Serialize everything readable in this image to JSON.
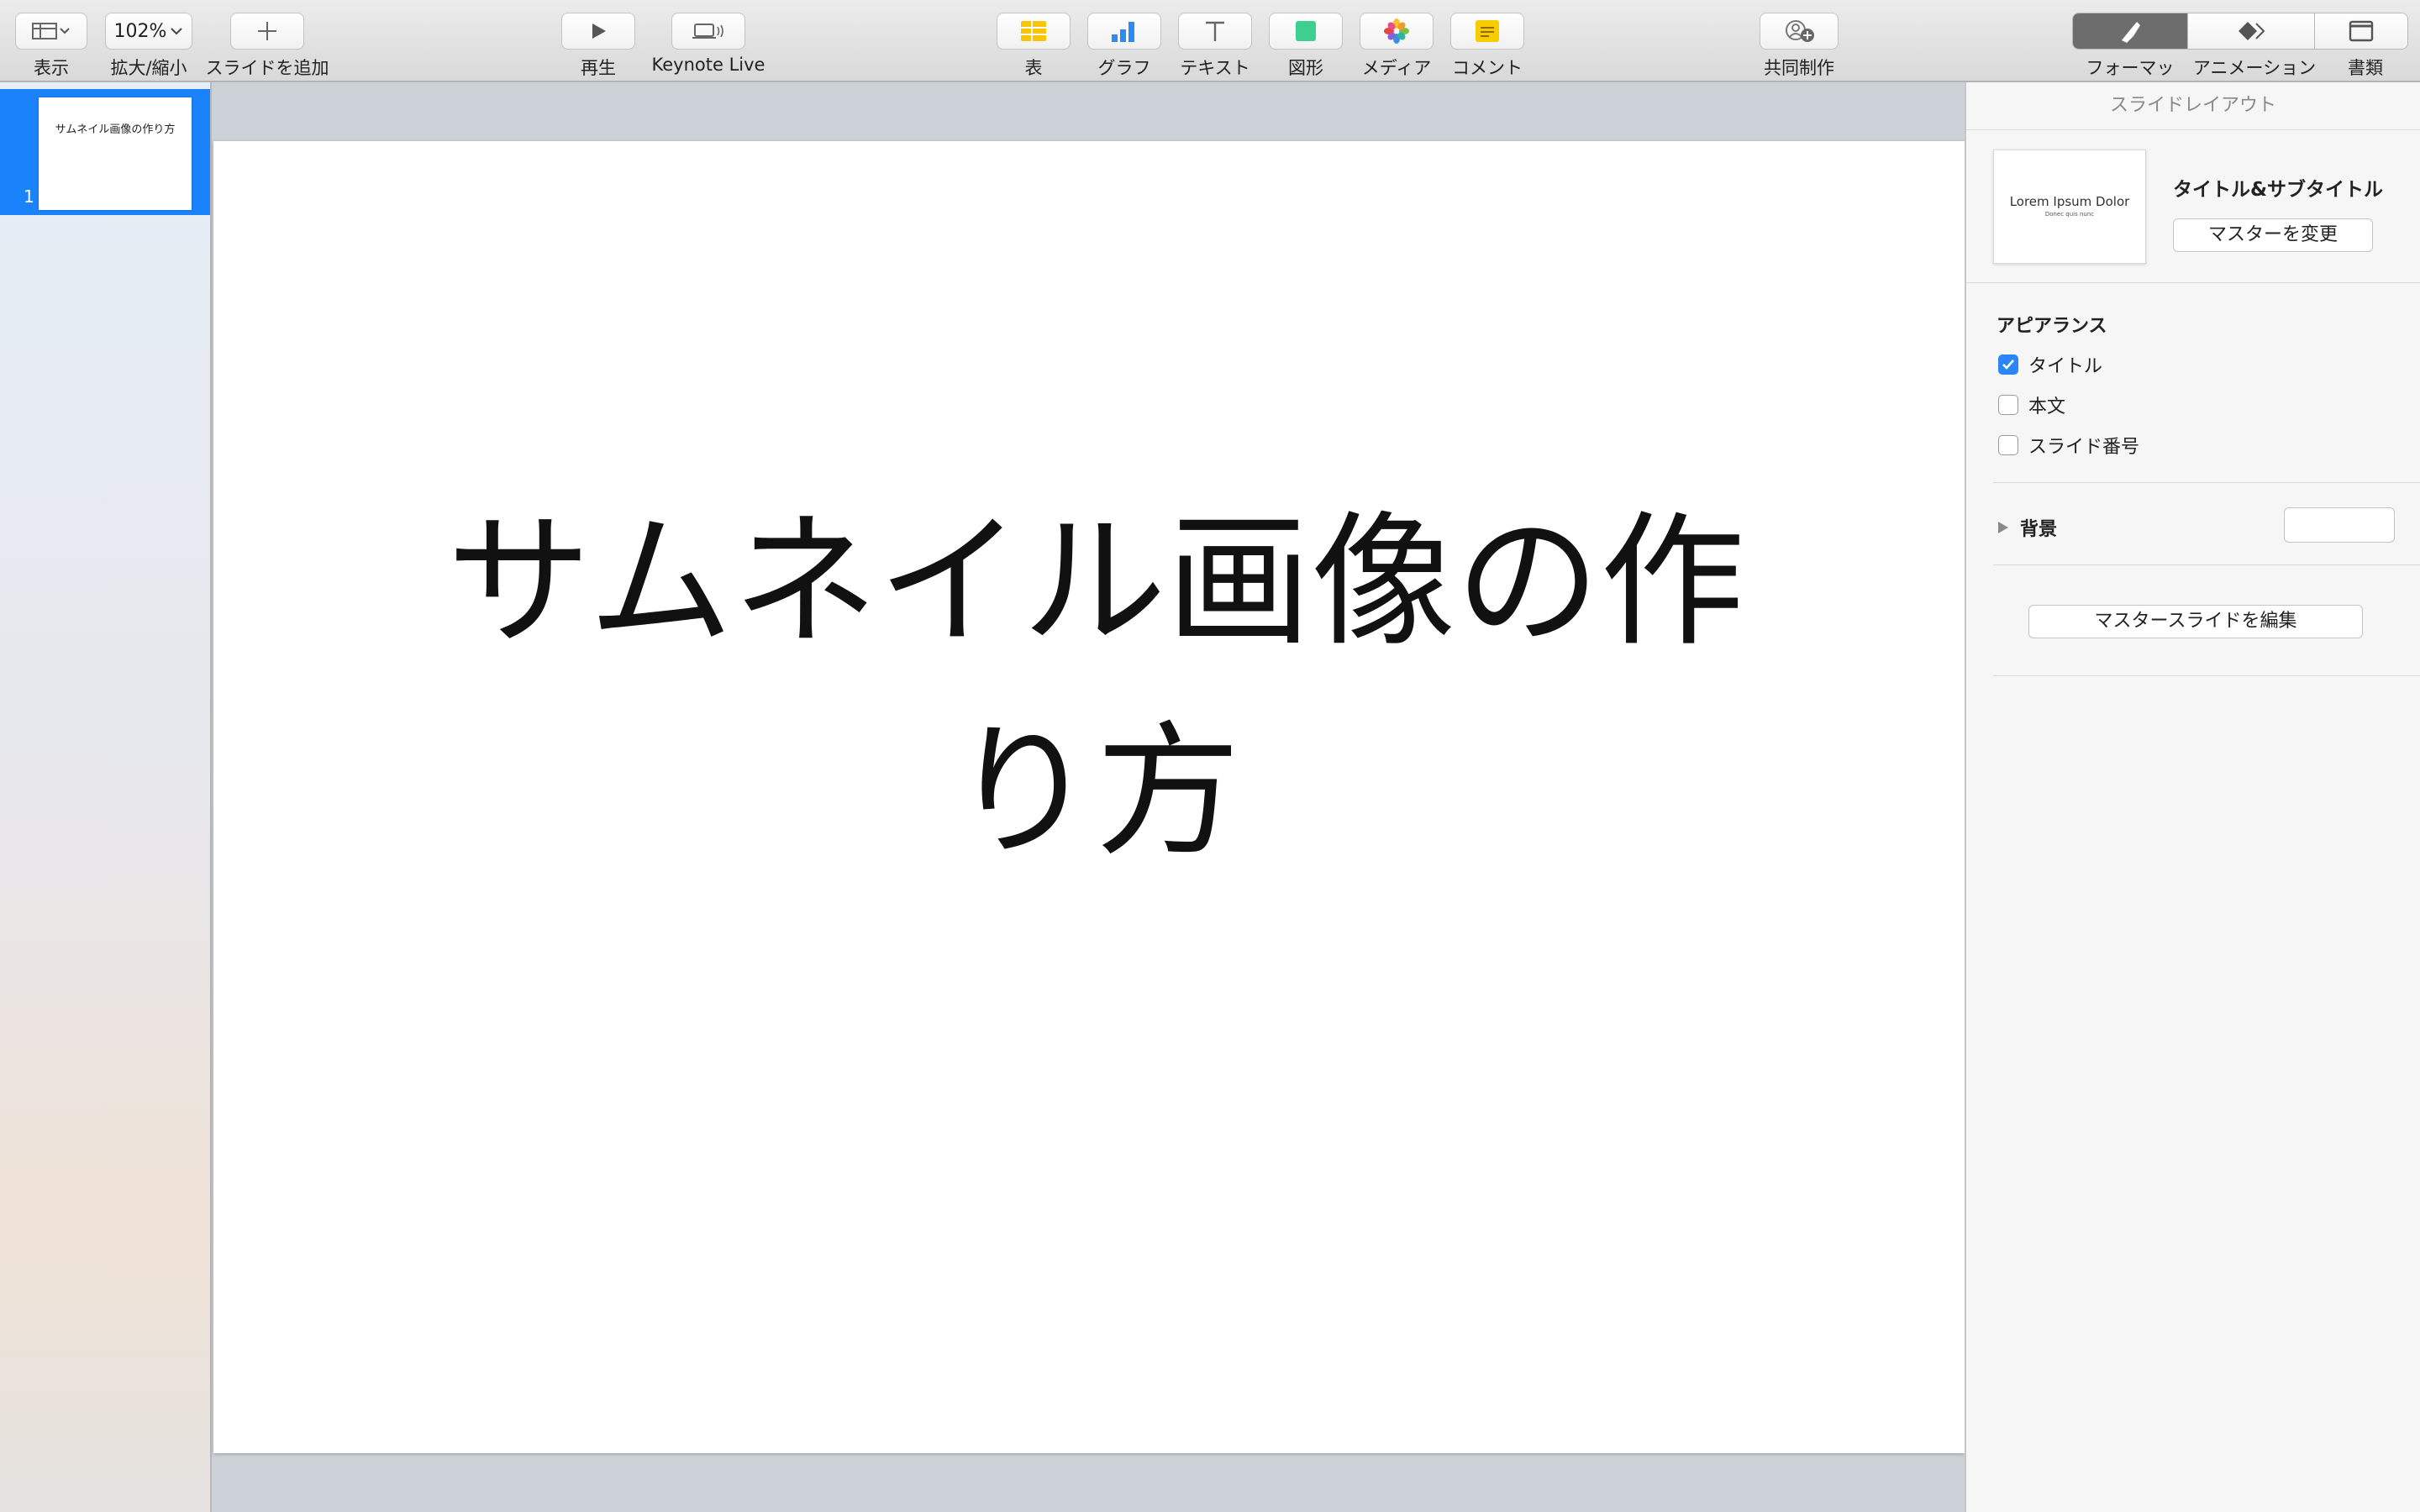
{
  "toolbar": {
    "view_label": "表示",
    "zoom_value": "102%",
    "zoom_label": "拡大/縮小",
    "add_slide_label": "スライドを追加",
    "play_label": "再生",
    "keynote_live_label": "Keynote Live",
    "table_label": "表",
    "chart_label": "グラフ",
    "text_label": "テキスト",
    "shape_label": "図形",
    "media_label": "メディア",
    "comment_label": "コメント",
    "collaborate_label": "共同制作",
    "format_label": "フォーマット",
    "animate_label": "アニメーション",
    "document_label": "書類"
  },
  "sidebar": {
    "slides": [
      {
        "number": "1",
        "thumb_text": "サムネイル画像の作り方",
        "selected": true
      }
    ]
  },
  "slide": {
    "title": "サムネイル画像の作り方"
  },
  "inspector": {
    "header": "スライドレイアウト",
    "layout_thumb_title": "Lorem Ipsum Dolor",
    "layout_thumb_subtitle": "Donec quis nunc",
    "layout_name": "タイトル&サブタイトル",
    "change_master_label": "マスターを変更",
    "appearance_title": "アピアランス",
    "appearance_options": [
      {
        "label": "タイトル",
        "checked": true
      },
      {
        "label": "本文",
        "checked": false
      },
      {
        "label": "スライド番号",
        "checked": false
      }
    ],
    "background_label": "背景",
    "edit_master_label": "マスタースライドを編集"
  },
  "colors": {
    "accent": "#1a82fb",
    "checkbox_on": "#2a86f5"
  }
}
